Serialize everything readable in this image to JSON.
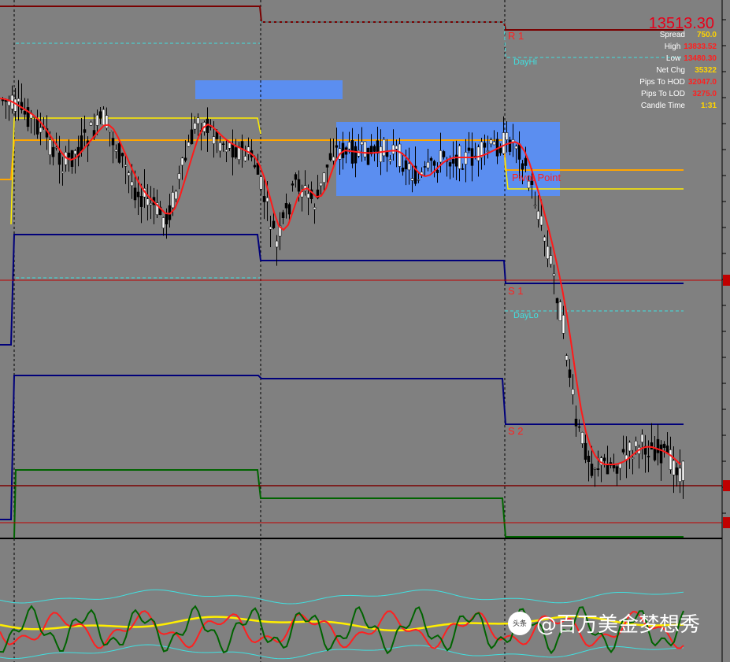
{
  "info_panel": {
    "price": "13513.30",
    "rows": [
      {
        "label": "Spread",
        "value": "750.0",
        "color": "#ffd400"
      },
      {
        "label": "High",
        "value": "13833.52",
        "color": "#ff2020"
      },
      {
        "label": "Low",
        "value": "13480.30",
        "color": "#ff2020"
      },
      {
        "label": "Net Chg",
        "value": "35322",
        "color": "#ffd400"
      },
      {
        "label": "Pips To HOD",
        "value": "32047.0",
        "color": "#ff2020"
      },
      {
        "label": "Pips To LOD",
        "value": "3275.0",
        "color": "#ff2020"
      },
      {
        "label": "Candle Time",
        "value": "1:31",
        "color": "#ffd400"
      }
    ]
  },
  "pivot_labels": {
    "r1": "R 1",
    "dayhi": "DayHi",
    "pivot": "Pivot Point",
    "s1": "S 1",
    "daylo": "DayLo",
    "s2": "S 2"
  },
  "watermark": {
    "logo": "头条",
    "text": "@百万美金梦想秀"
  },
  "colors": {
    "background": "#808080",
    "candle_bull": "#3a3a3a",
    "candle_bear": "#000000",
    "ma": "#ff1a1a",
    "r1": "#7a0000",
    "pivot": "#ffa500",
    "s1": "#00007a",
    "s2": "#00007a",
    "s3": "#006400",
    "dayhilo": "#40e0e0",
    "zone": "#5b8ef0"
  }
}
